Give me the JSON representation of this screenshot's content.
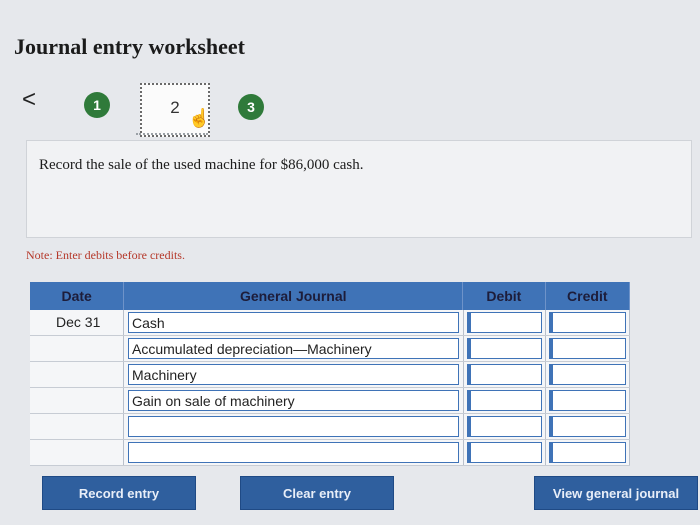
{
  "header": {
    "title": "Journal entry worksheet"
  },
  "nav": {
    "back_glyph": "<",
    "steps": [
      "1",
      "2",
      "3"
    ],
    "active_step": "2",
    "hand_glyph": "☝"
  },
  "prompt": {
    "text": "Record the sale of the used machine for $86,000 cash."
  },
  "note": {
    "text": "Note: Enter debits before credits."
  },
  "journal": {
    "headers": {
      "date": "Date",
      "general_journal": "General Journal",
      "debit": "Debit",
      "credit": "Credit"
    },
    "rows": [
      {
        "date": "Dec 31",
        "account": "Cash",
        "debit": "",
        "credit": ""
      },
      {
        "date": "",
        "account": "Accumulated depreciation—Machinery",
        "debit": "",
        "credit": ""
      },
      {
        "date": "",
        "account": "Machinery",
        "debit": "",
        "credit": ""
      },
      {
        "date": "",
        "account": "Gain on sale of machinery",
        "debit": "",
        "credit": ""
      },
      {
        "date": "",
        "account": "",
        "debit": "",
        "credit": ""
      },
      {
        "date": "",
        "account": "",
        "debit": "",
        "credit": ""
      }
    ]
  },
  "buttons": {
    "record": "Record entry",
    "clear": "Clear entry",
    "view": "View general journal"
  },
  "colors": {
    "accent": "#3f73b7",
    "step_green": "#2f7a3a",
    "button_blue": "#2f5f9e",
    "note_red": "#b5392b"
  }
}
